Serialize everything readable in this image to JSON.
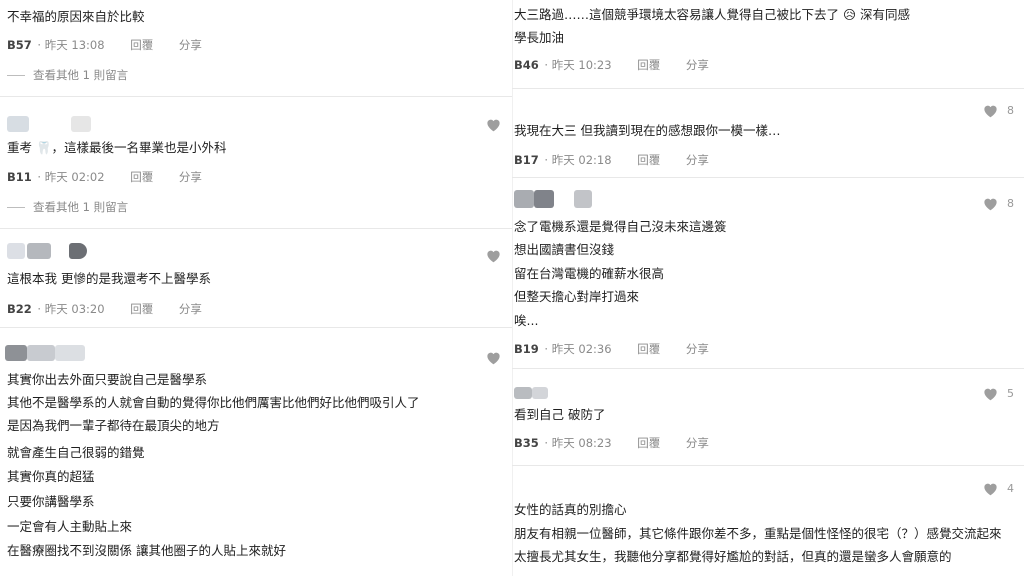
{
  "actions": {
    "reply": "回覆",
    "share": "分享"
  },
  "colors": {
    "heart": "#9e9e9e",
    "meta": "#8a8a8a",
    "separator": "#e8e8e8"
  },
  "left": {
    "c1": {
      "text": [
        "不幸福的原因來自於比較"
      ],
      "floor": "B57",
      "time": "昨天 13:08",
      "view_more": "查看其他 1 則留言"
    },
    "c2": {
      "text": [
        "重考 🦷，這樣最後一名畢業也是小外科"
      ],
      "floor": "B11",
      "time": "昨天 02:02",
      "view_more": "查看其他 1 則留言"
    },
    "c3": {
      "text": [
        "這根本我 更慘的是我還考不上醫學系"
      ],
      "floor": "B22",
      "time": "昨天 03:20"
    },
    "c4": {
      "text": [
        "其實你出去外面只要說自己是醫學系",
        "其他不是醫學系的人就會自動的覺得你比他們厲害比他們好比他們吸引人了",
        "是因為我們一輩子都待在最頂尖的地方",
        "就會產生自己很弱的錯覺",
        "其實你真的超猛",
        "只要你講醫學系",
        "一定會有人主動貼上來",
        "在醫療圈找不到沒關係 讓其他圈子的人貼上來就好"
      ]
    }
  },
  "right": {
    "c1": {
      "text": [
        "大三路過……這個競爭環境太容易讓人覺得自己被比下去了 😥 深有同感",
        "學長加油"
      ],
      "floor": "B46",
      "time": "昨天 10:23"
    },
    "c2": {
      "likes": "8",
      "text": [
        "我現在大三 但我讀到現在的感想跟你一模一樣…"
      ],
      "floor": "B17",
      "time": "昨天 02:18"
    },
    "c3": {
      "likes": "8",
      "text": [
        "念了電機系還是覺得自己沒未來這邊簽",
        "想出國讀書但沒錢",
        "留在台灣電機的確薪水很高",
        "但整天擔心對岸打過來",
        "唉..."
      ],
      "floor": "B19",
      "time": "昨天 02:36"
    },
    "c4": {
      "likes": "5",
      "text": [
        "看到自己 破防了"
      ],
      "floor": "B35",
      "time": "昨天 08:23"
    },
    "c5": {
      "likes": "4",
      "text": [
        "女性的話真的別擔心",
        "朋友有相親一位醫師，其它條件跟你差不多，重點是個性怪怪的很宅（？）感覺交流起來",
        "太擅長尤其女生，我聽他分享都覺得好尷尬的對話，但真的還是蠻多人會願意的"
      ]
    }
  }
}
